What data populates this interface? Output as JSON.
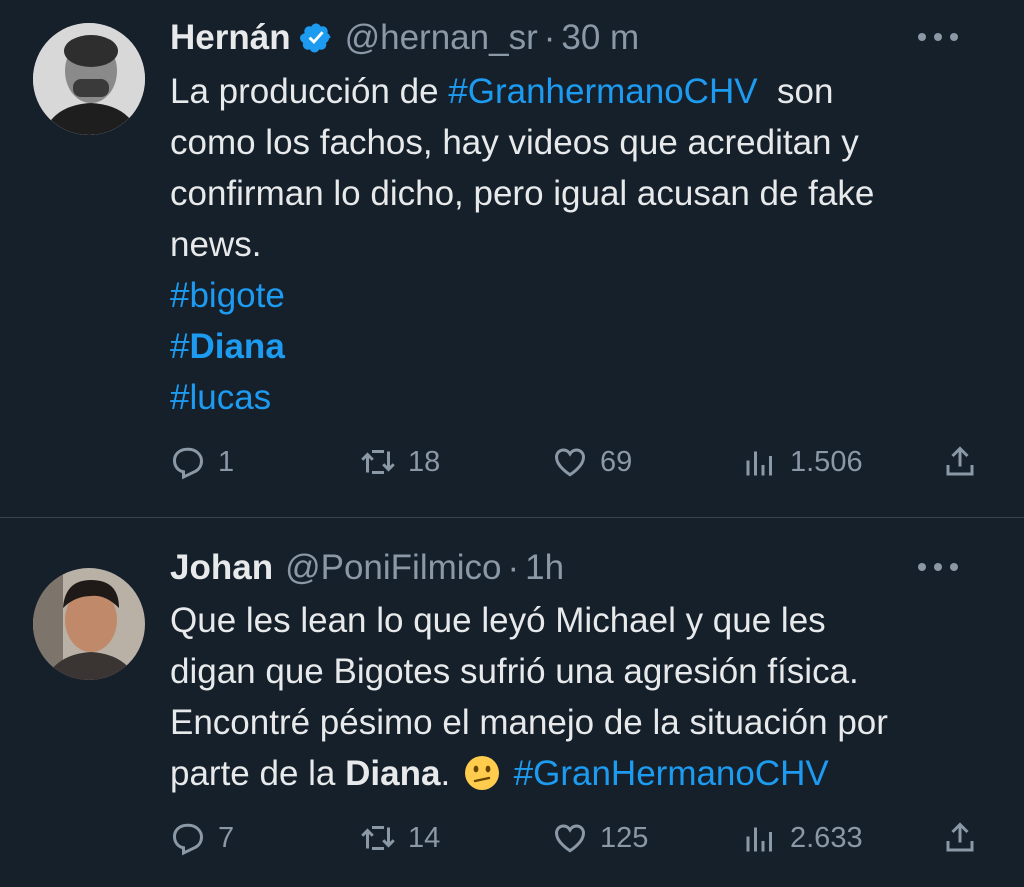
{
  "tweets": [
    {
      "name": "Hernán",
      "verified": true,
      "handle": "@hernan_sr",
      "separator": "·",
      "time": "30 m",
      "text_parts": {
        "p1": "La producción de ",
        "tag1": "#GranhermanoCHV",
        "p2": "  son",
        "line2": "como los fachos, hay videos que acreditan y",
        "line3": "confirman lo dicho, pero igual acusan de fake",
        "line4": "news.",
        "tag2": "#bigote",
        "tag3_hash": "#",
        "tag3_word": "Diana",
        "tag4": "#lucas"
      },
      "replies": "1",
      "retweets": "18",
      "likes": "69",
      "views": "1.506"
    },
    {
      "name": "Johan",
      "verified": false,
      "handle": "@PoniFilmico",
      "separator": "·",
      "time": "1h",
      "text_parts": {
        "line1": "Que les lean lo que leyó Michael y que les",
        "line2": "digan que Bigotes sufrió una agresión física.",
        "line3": "Encontré pésimo el manejo de la situación por",
        "p4a": "parte de la ",
        "p4b": "Diana",
        "p4c": ".",
        "tag1": "#GranHermanoCHV"
      },
      "emoji": "confused-face",
      "replies": "7",
      "retweets": "14",
      "likes": "125",
      "views": "2.633"
    }
  ],
  "colors": {
    "background": "#15202b",
    "text": "#e7e9ea",
    "muted": "#8b98a5",
    "link": "#1d9bf0",
    "divider": "#38444d"
  }
}
